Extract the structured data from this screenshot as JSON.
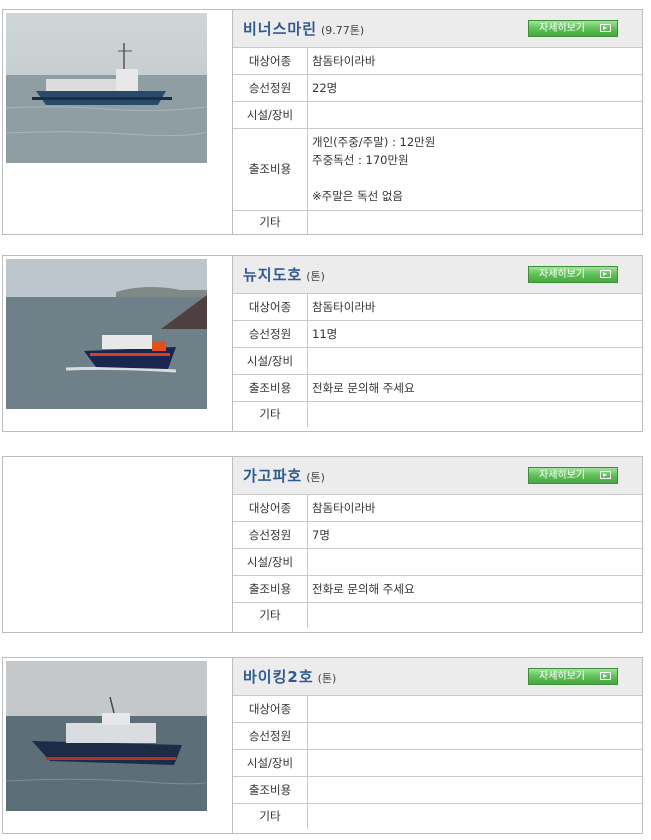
{
  "detail_button_label": "자세히보기",
  "boats": [
    {
      "name": "비너스마린",
      "ton": "(9.77톤)",
      "labels": [
        "대상어종",
        "승선정원",
        "시설/장비",
        "출조비용",
        "기타"
      ],
      "target_fish": "참돔타이라바",
      "capacity": "22명",
      "facilities": "",
      "fee_lines": [
        "개인(주중/주말) : 12만원",
        "주중독선 : 170만원",
        "",
        "※주말은 독선 없음"
      ],
      "etc": ""
    },
    {
      "name": "뉴지도호",
      "ton": "(톤)",
      "labels": [
        "대상어종",
        "승선정원",
        "시설/장비",
        "출조비용",
        "기타"
      ],
      "target_fish": "참돔타이라바",
      "capacity": "11명",
      "facilities": "",
      "fee": "전화로 문의해 주세요",
      "etc": ""
    },
    {
      "name": "가고파호",
      "ton": "(톤)",
      "labels": [
        "대상어종",
        "승선정원",
        "시설/장비",
        "출조비용",
        "기타"
      ],
      "target_fish": "참돔타이라바",
      "capacity": "7명",
      "facilities": "",
      "fee": "전화로 문의해 주세요",
      "etc": ""
    },
    {
      "name": "바이킹2호",
      "ton": "(톤)",
      "labels": [
        "대상어종",
        "승선정원",
        "시설/장비",
        "출조비용",
        "기타"
      ],
      "target_fish": "",
      "capacity": "",
      "facilities": "",
      "fee": "",
      "etc": ""
    }
  ]
}
